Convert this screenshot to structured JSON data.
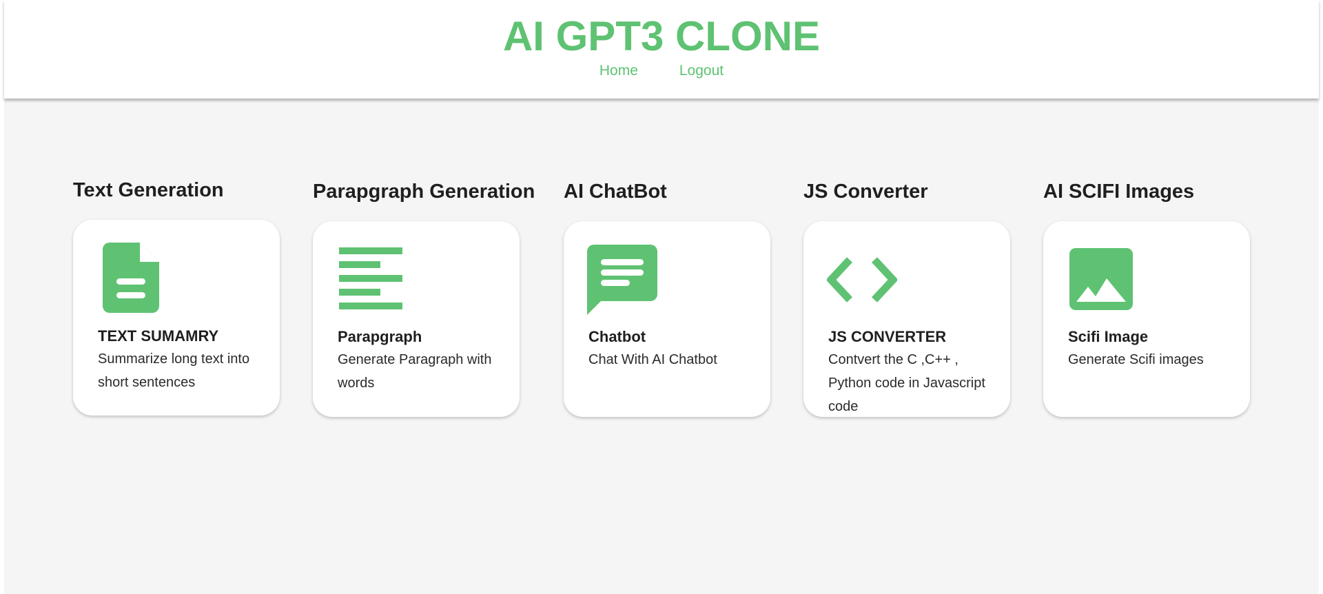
{
  "header": {
    "title": "AI GPT3 CLONE",
    "nav": [
      {
        "label": "Home"
      },
      {
        "label": "Logout"
      }
    ]
  },
  "colors": {
    "accent": "#5ec272",
    "background": "#f5f5f5",
    "card": "#ffffff",
    "text": "#1f1f1f"
  },
  "sections": [
    {
      "heading": "Text Generation",
      "icon": "document-icon",
      "card_title": "TEXT SUMAMRY",
      "card_desc": "Summarize long text into short sentences"
    },
    {
      "heading": "Parapgraph Generation",
      "icon": "paragraph-lines-icon",
      "card_title": "Parapgraph",
      "card_desc": "Generate Paragraph with words"
    },
    {
      "heading": "AI ChatBot",
      "icon": "chat-bubble-icon",
      "card_title": "Chatbot",
      "card_desc": "Chat With AI Chatbot"
    },
    {
      "heading": "JS Converter",
      "icon": "code-brackets-icon",
      "card_title": "JS CONVERTER",
      "card_desc": "Contvert the C ,C++ , Python code in Javascript code"
    },
    {
      "heading": "AI SCIFI Images",
      "icon": "image-icon",
      "card_title": "Scifi Image",
      "card_desc": "Generate Scifi images"
    }
  ]
}
